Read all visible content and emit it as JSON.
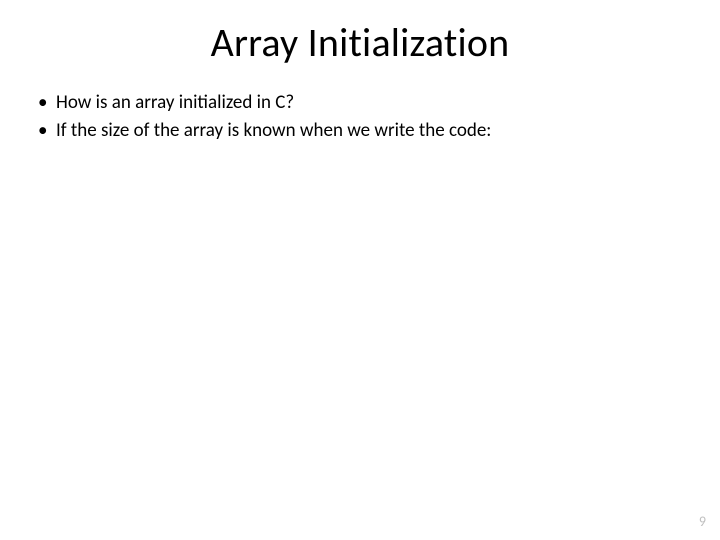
{
  "slide": {
    "title": "Array Initialization",
    "bullets": [
      "How is an array initialized in C?",
      "If the size of the array is known when we write the code:"
    ],
    "page_number": "9"
  }
}
